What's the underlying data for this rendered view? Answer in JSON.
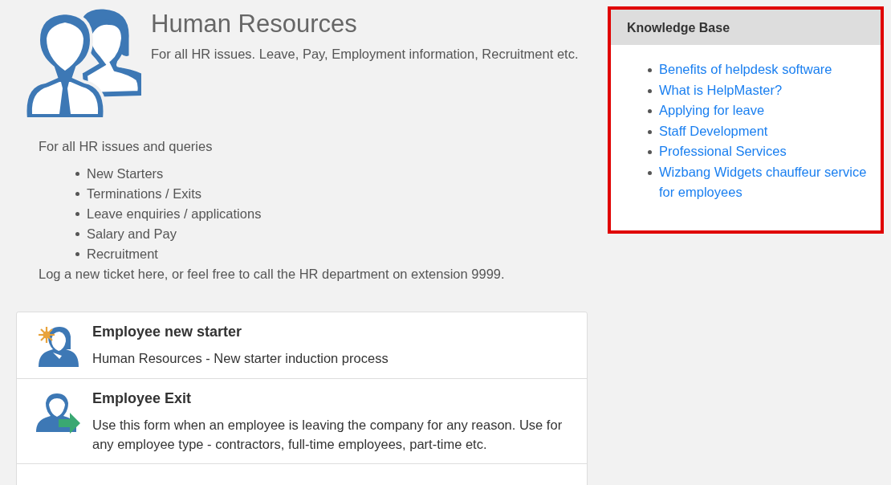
{
  "header": {
    "title": "Human Resources",
    "description": "For all HR issues. Leave, Pay, Employment information, Recruitment etc."
  },
  "intro": "For all HR issues and queries",
  "topics": [
    "New Starters",
    "Terminations / Exits",
    "Leave enquiries / applications",
    "Salary and Pay",
    "Recruitment"
  ],
  "note": "Log a new ticket here, or feel free to call the HR department on extension 9999.",
  "forms": [
    {
      "kind": "new-starter",
      "title": "Employee new starter",
      "description": "Human Resources - New starter induction process"
    },
    {
      "kind": "exit",
      "title": "Employee Exit",
      "description": "Use this form when an employee is leaving the company for any reason. Use for any employee type - contractors, full-time employees, part-time etc."
    }
  ],
  "knowledge_base": {
    "title": "Knowledge Base",
    "highlighted": true,
    "links": [
      "Benefits of helpdesk software",
      "What is HelpMaster?",
      "Applying for leave",
      "Staff Development",
      "Professional Services",
      "Wizbang Widgets chauffeur service for employees"
    ]
  }
}
